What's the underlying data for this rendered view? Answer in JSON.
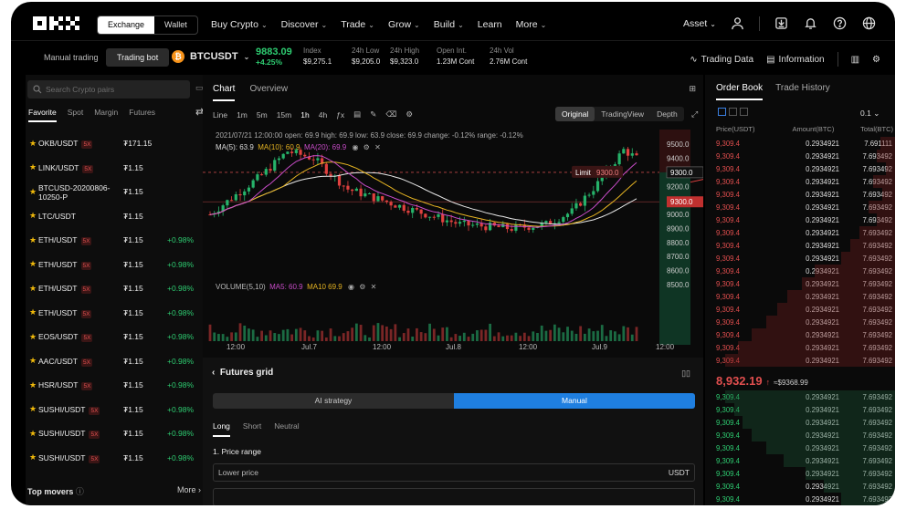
{
  "nav": {
    "exchange": "Exchange",
    "wallet": "Wallet",
    "menu": [
      {
        "label": "Buy Crypto",
        "caret": true
      },
      {
        "label": "Discover",
        "caret": true
      },
      {
        "label": "Trade",
        "caret": true
      },
      {
        "label": "Grow",
        "caret": true
      },
      {
        "label": "Build",
        "caret": true
      },
      {
        "label": "Learn",
        "caret": false
      },
      {
        "label": "More",
        "caret": true
      }
    ],
    "asset": "Asset"
  },
  "ticker": {
    "manual": "Manual trading",
    "bot": "Trading bot",
    "pair": "BTCUSDT",
    "price": "9883.09",
    "change": "+4.25%",
    "stats": [
      {
        "label": "Index",
        "value": "$9,275.1"
      },
      {
        "label": "24h Low",
        "value": "$9,205.0"
      },
      {
        "label": "24h High",
        "value": "$9,323.0"
      },
      {
        "label": "Open Int.",
        "value": "1.23M Cont"
      },
      {
        "label": "24h Vol",
        "value": "2.76M Cont"
      }
    ],
    "trading_data": "Trading Data",
    "information": "Information"
  },
  "left": {
    "search_placeholder": "Search Crypto pairs",
    "tabs": [
      "Favorite",
      "Spot",
      "Margin",
      "Futures"
    ],
    "pairs": [
      {
        "name": "OKB/USDT",
        "lev": "5X",
        "price": "₮171.15",
        "change": ""
      },
      {
        "name": "LINK/USDT",
        "lev": "5X",
        "price": "₮1.15",
        "change": ""
      },
      {
        "name": "BTCUSD-20200806-10250-P",
        "lev": "",
        "price": "₮1.15",
        "change": ""
      },
      {
        "name": "LTC/USDT",
        "lev": "",
        "price": "₮1.15",
        "change": ""
      },
      {
        "name": "ETH/USDT",
        "lev": "5X",
        "price": "₮1.15",
        "change": "+0.98%"
      },
      {
        "name": "ETH/USDT",
        "lev": "5X",
        "price": "₮1.15",
        "change": "+0.98%"
      },
      {
        "name": "ETH/USDT",
        "lev": "5X",
        "price": "₮1.15",
        "change": "+0.98%"
      },
      {
        "name": "ETH/USDT",
        "lev": "5X",
        "price": "₮1.15",
        "change": "+0.98%"
      },
      {
        "name": "EOS/USDT",
        "lev": "5X",
        "price": "₮1.15",
        "change": "+0.98%"
      },
      {
        "name": "AAC/USDT",
        "lev": "5X",
        "price": "₮1.15",
        "change": "+0.98%"
      },
      {
        "name": "HSR/USDT",
        "lev": "5X",
        "price": "₮1.15",
        "change": "+0.98%"
      },
      {
        "name": "SUSHI/USDT",
        "lev": "5X",
        "price": "₮1.15",
        "change": "+0.98%"
      },
      {
        "name": "SUSHI/USDT",
        "lev": "5X",
        "price": "₮1.15",
        "change": "+0.98%"
      },
      {
        "name": "SUSHI/USDT",
        "lev": "5X",
        "price": "₮1.15",
        "change": "+0.98%"
      }
    ],
    "movers": "Top movers",
    "more": "More"
  },
  "chart": {
    "tabs": [
      "Chart",
      "Overview"
    ],
    "intervals": [
      "Line",
      "1m",
      "5m",
      "15m",
      "1h",
      "4h"
    ],
    "active_interval": "1h",
    "views": [
      "Original",
      "TradingView",
      "Depth"
    ],
    "ohlc": "2021/07/21 12:00:00  open: 69.9  high: 69.9  low: 63.9  close: 69.9  change: -0.12%  range: -0.12%",
    "ma": {
      "ma5": "MA(5): 63.9",
      "ma10": "MA(10): 60.9",
      "ma20": "MA(20): 69.9"
    },
    "volume": {
      "label": "VOLUME(5,10)",
      "ma5": "MA5: 60.9",
      "ma10": "MA10 69.9"
    },
    "y_ticks": [
      "9500.0",
      "9400.0",
      "9300.0",
      "9200.0",
      "9100.0",
      "9000.0",
      "8900.0",
      "8800.0",
      "8700.0",
      "8600.0",
      "8500.0"
    ],
    "y_range": [
      8500,
      9540
    ],
    "x_ticks": [
      "12:00",
      "Jul.7",
      "12:00",
      "Jul.8",
      "12:00",
      "Jul.9",
      "12:00"
    ],
    "limit_label": "Limit",
    "limit_price": "9300.0",
    "price_tag_1": "9300.0",
    "price_tag_2": "9300.0",
    "colors": {
      "up": "#26b36a",
      "down": "#e0413f",
      "ma5": "#e8e8e8",
      "ma10": "#e6b422",
      "ma20": "#c84cc8"
    }
  },
  "grid": {
    "title": "Futures grid",
    "strategies": [
      "AI strategy",
      "Manual"
    ],
    "tabs": [
      "Long",
      "Short",
      "Neutral"
    ],
    "price_range": "1. Price range",
    "lower_price": "Lower price",
    "unit": "USDT"
  },
  "orderbook": {
    "tabs": [
      "Order Book",
      "Trade History"
    ],
    "step": "0.1",
    "headers": [
      "Price(USDT)",
      "Amount(BTC)",
      "Total(BTC)"
    ],
    "asks": [
      {
        "p": "9,309.4",
        "a": "0.2934921",
        "t": "7.691111",
        "d": 0.08
      },
      {
        "p": "9,309.4",
        "a": "0.2934921",
        "t": "7.693492",
        "d": 0.1
      },
      {
        "p": "9,309.4",
        "a": "0.2934921",
        "t": "7.693492",
        "d": 0.05
      },
      {
        "p": "9,309.4",
        "a": "0.2934921",
        "t": "7.693492",
        "d": 0.12
      },
      {
        "p": "9,309.4",
        "a": "0.2934921",
        "t": "7.693492",
        "d": 0.07
      },
      {
        "p": "9,309.4",
        "a": "0.2934921",
        "t": "7.693492",
        "d": 0.15
      },
      {
        "p": "9,309.4",
        "a": "0.2934921",
        "t": "7.693492",
        "d": 0.1
      },
      {
        "p": "9,309.4",
        "a": "0.2934921",
        "t": "7.693492",
        "d": 0.2
      },
      {
        "p": "9,309.4",
        "a": "0.2934921",
        "t": "7.693492",
        "d": 0.25
      },
      {
        "p": "9,309.4",
        "a": "0.2934921",
        "t": "7.693492",
        "d": 0.3
      },
      {
        "p": "9,309.4",
        "a": "0.2934921",
        "t": "7.693492",
        "d": 0.45
      },
      {
        "p": "9,309.4",
        "a": "0.2934921",
        "t": "7.693492",
        "d": 0.52
      },
      {
        "p": "9,309.4",
        "a": "0.2934921",
        "t": "7.693492",
        "d": 0.6
      },
      {
        "p": "9,309.4",
        "a": "0.2934921",
        "t": "7.693492",
        "d": 0.66
      },
      {
        "p": "9,309.4",
        "a": "0.2934921",
        "t": "7.693492",
        "d": 0.72
      },
      {
        "p": "9,309.4",
        "a": "0.2934921",
        "t": "7.693492",
        "d": 0.8
      },
      {
        "p": "9,309.4",
        "a": "0.2934921",
        "t": "7.693492",
        "d": 0.88
      },
      {
        "p": "9,309.4",
        "a": "0.2934921",
        "t": "7.693492",
        "d": 0.95
      }
    ],
    "last": "8,932.19",
    "last_arrow": "↑",
    "last_equiv": "≈$9368.99",
    "bids": [
      {
        "p": "9,309.4",
        "a": "0.2934921",
        "t": "7.693492",
        "d": 0.95
      },
      {
        "p": "9,309.4",
        "a": "0.2934921",
        "t": "7.693492",
        "d": 0.9
      },
      {
        "p": "9,309.4",
        "a": "0.2934921",
        "t": "7.693492",
        "d": 0.85
      },
      {
        "p": "9,309.4",
        "a": "0.2934921",
        "t": "7.693492",
        "d": 0.8
      },
      {
        "p": "9,309.4",
        "a": "0.2934921",
        "t": "7.693492",
        "d": 0.72
      },
      {
        "p": "9,309.4",
        "a": "0.2934921",
        "t": "7.693492",
        "d": 0.62
      },
      {
        "p": "9,309.4",
        "a": "0.2934921",
        "t": "7.693492",
        "d": 0.5
      },
      {
        "p": "9,309.4",
        "a": "0.2934921",
        "t": "7.693492",
        "d": 0.4
      },
      {
        "p": "9,309.4",
        "a": "0.2934921",
        "t": "7.693492",
        "d": 0.3
      }
    ]
  }
}
